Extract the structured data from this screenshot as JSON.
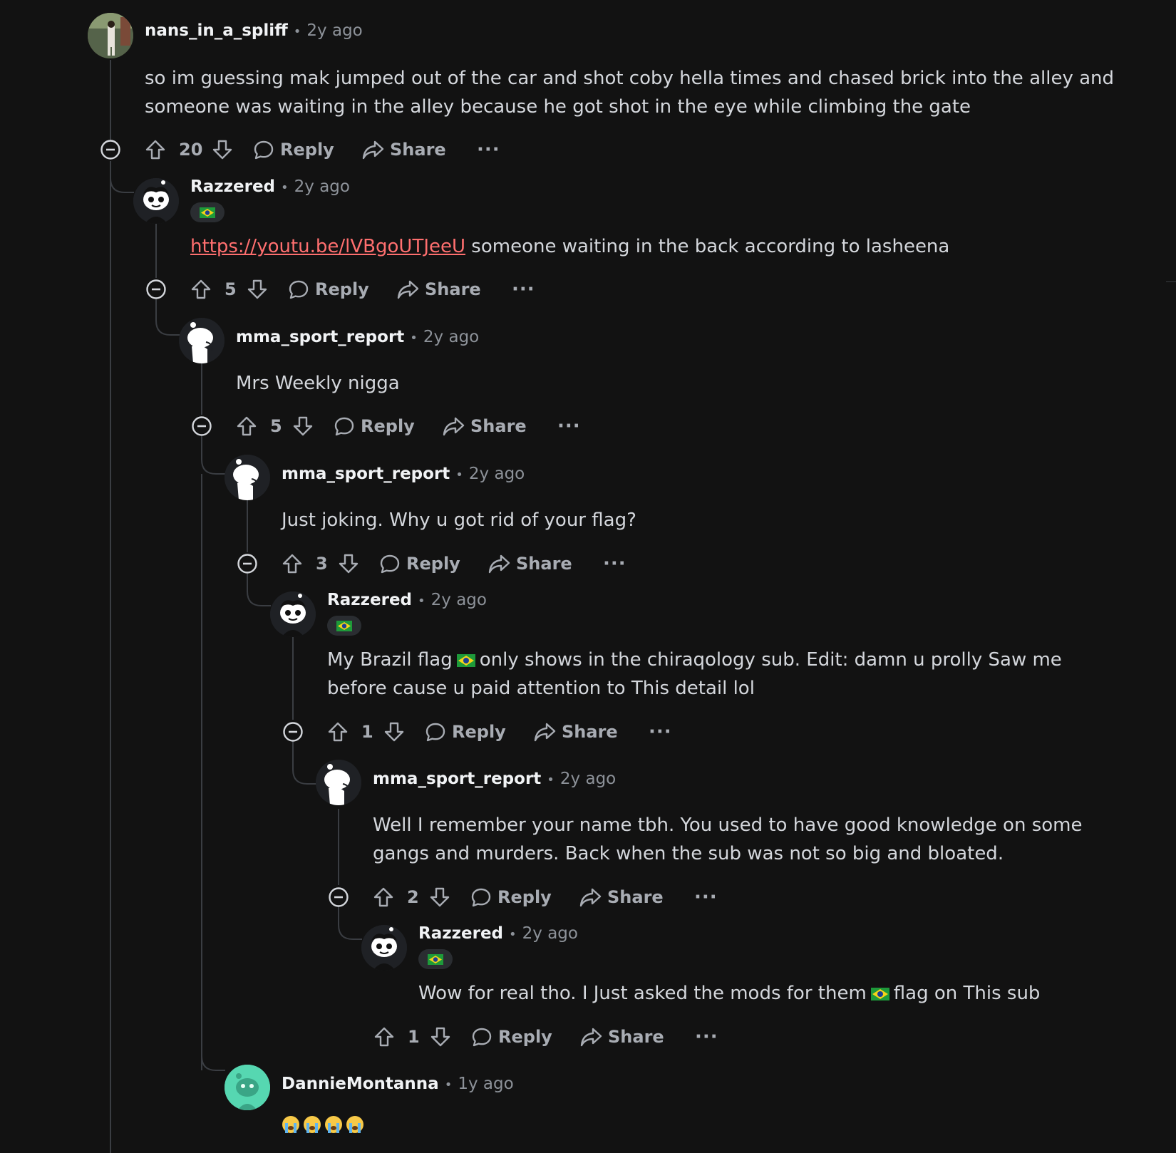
{
  "comments": [
    {
      "username": "nans_in_a_spliff",
      "age": "2y ago",
      "avatar": "photo",
      "body_parts": [
        "so im guessing mak jumped out of the car and shot coby hella times and chased brick into the alley and someone was waiting in the alley because he got shot in the eye while climbing the gate"
      ],
      "score": "20"
    },
    {
      "username": "Razzered",
      "age": "2y ago",
      "avatar": "snoo-razzered",
      "flair": "brazil-flag-icon",
      "link": "https://youtu.be/lVBgoUTJeeU",
      "body_after_link": " someone waiting in the back according to lasheena",
      "score": "5"
    },
    {
      "username": "mma_sport_report",
      "age": "2y ago",
      "avatar": "snoo-white",
      "body_parts": [
        "Mrs Weekly nigga"
      ],
      "score": "5"
    },
    {
      "username": "mma_sport_report",
      "age": "2y ago",
      "avatar": "snoo-white",
      "body_parts": [
        "Just joking. Why u got rid of your flag?"
      ],
      "score": "3"
    },
    {
      "username": "Razzered",
      "age": "2y ago",
      "avatar": "snoo-razzered",
      "flair": "brazil-flag-icon",
      "body_before_flag": "My Brazil flag",
      "body_after_flag": "only shows in the chiraqology sub. Edit: damn u prolly Saw me before cause u paid attention to This detail lol",
      "score": "1"
    },
    {
      "username": "mma_sport_report",
      "age": "2y ago",
      "avatar": "snoo-white",
      "body_parts": [
        "Well I remember your name tbh. You used to have good knowledge on some gangs and murders. Back when the sub was not so big and bloated."
      ],
      "score": "2"
    },
    {
      "username": "Razzered",
      "age": "2y ago",
      "avatar": "snoo-razzered",
      "flair": "brazil-flag-icon",
      "body_before_flag": "Wow for real tho. I Just asked the mods for them",
      "body_after_flag": "flag on This sub",
      "score": "1"
    },
    {
      "username": "DannieMontanna",
      "age": "1y ago",
      "avatar": "snoo-mint",
      "body_parts": [
        "😭😭😭😭"
      ]
    }
  ],
  "actions": {
    "reply_label": "Reply",
    "share_label": "Share",
    "more_label": "···"
  },
  "colors": {
    "background": "#121212",
    "link": "#ff6f6f",
    "muted": "#8d9299",
    "thread_line": "#3a3d42"
  }
}
